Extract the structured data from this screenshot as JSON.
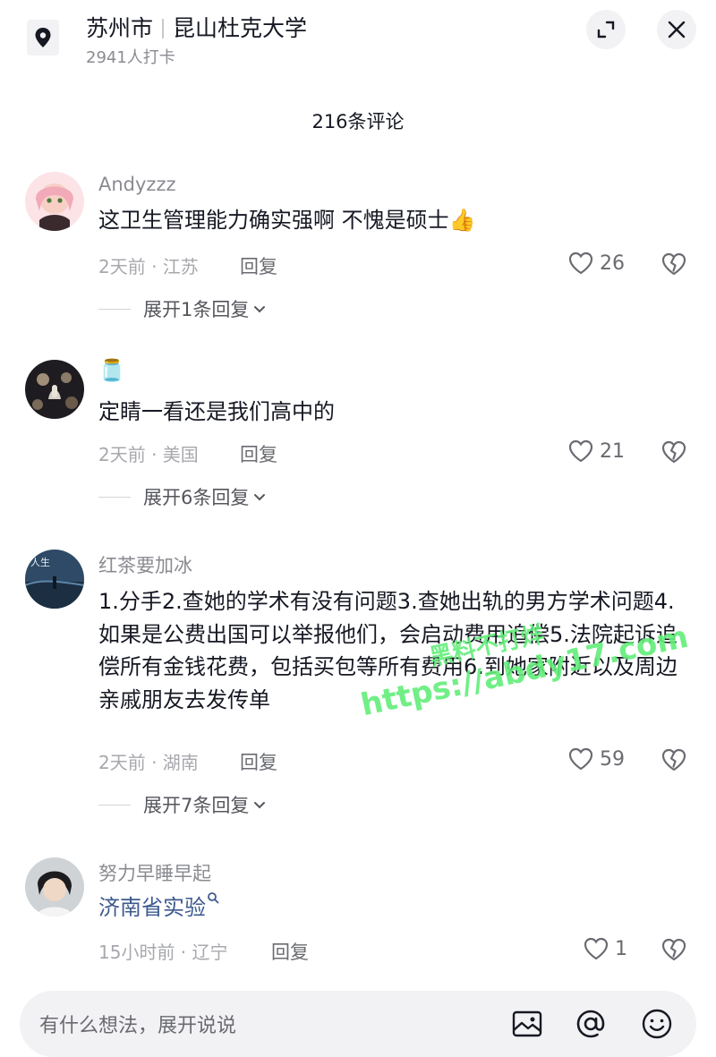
{
  "header": {
    "city": "苏州市",
    "place": "昆山杜克大学",
    "checkins": "2941人打卡"
  },
  "comment_count": "216条评论",
  "comments": [
    {
      "username": "Andyzzz",
      "text": "这卫生管理能力确实强啊 不愧是硕士👍",
      "meta": "2天前 · 江苏",
      "reply_label": "回复",
      "likes": "26",
      "expand": "展开1条回复"
    },
    {
      "username": "🫙",
      "text": "定睛一看还是我们高中的",
      "meta": "2天前 · 美国",
      "reply_label": "回复",
      "likes": "21",
      "expand": "展开6条回复"
    },
    {
      "username": "红茶要加冰",
      "text": "1.分手2.查她的学术有没有问题3.查她出轨的男方学术问题4.如果是公费出国可以举报他们，会启动费用追偿5.法院起诉追偿所有金钱花费，包括买包等所有费用6.到她家附近以及周边亲戚朋友去发传单",
      "meta": "2天前 · 湖南",
      "reply_label": "回复",
      "likes": "59",
      "expand": "展开7条回复"
    },
    {
      "username": "努力早睡早起",
      "text": "济南省实验",
      "meta": "15小时前 · 辽宁",
      "reply_label": "回复",
      "likes": "1"
    }
  ],
  "input": {
    "placeholder": "有什么想法，展开说说"
  },
  "watermark": {
    "line1": "黑料不打烊",
    "line2": "https://abdy17.com"
  },
  "colors": {
    "link": "#3d5a8f",
    "watermark": "#62ee7a"
  },
  "icons": [
    "location-pin-icon",
    "expand-icon",
    "close-icon",
    "heart-icon",
    "broken-heart-icon",
    "chevron-down-icon",
    "search-icon",
    "image-icon",
    "at-icon",
    "emoji-icon"
  ]
}
